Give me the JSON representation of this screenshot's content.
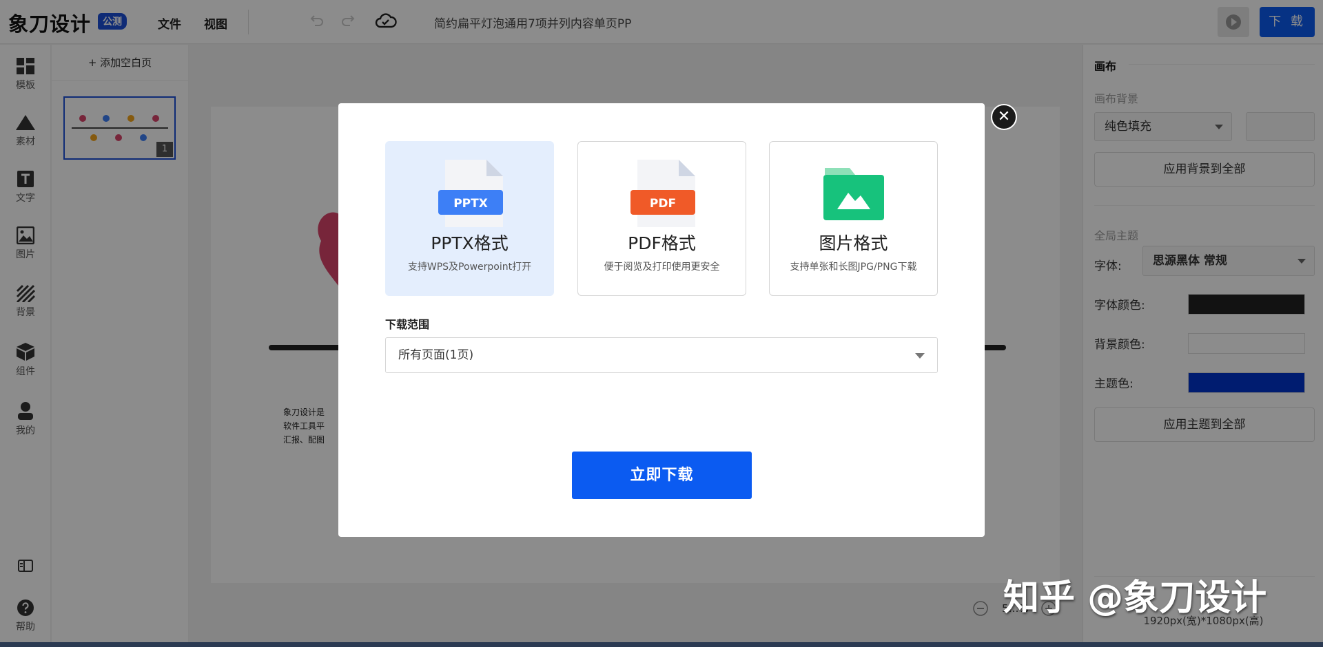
{
  "app": {
    "logo_text": "象刀设计",
    "beta_badge": "公测",
    "document_title": "简约扁平灯泡通用7项并列内容单页PP"
  },
  "topbar": {
    "menu": [
      "文件",
      "视图"
    ],
    "download_label": "下 载"
  },
  "iconbar": {
    "items": [
      {
        "label": "模板",
        "icon": "template-icon"
      },
      {
        "label": "素材",
        "icon": "material-icon"
      },
      {
        "label": "文字",
        "icon": "text-icon"
      },
      {
        "label": "图片",
        "icon": "image-icon"
      },
      {
        "label": "背景",
        "icon": "background-icon"
      },
      {
        "label": "组件",
        "icon": "component-icon"
      },
      {
        "label": "我的",
        "icon": "user-icon"
      }
    ],
    "help_label": "帮助"
  },
  "pages": {
    "add_label": "+ 添加空白页",
    "thumb_number": "1"
  },
  "canvas": {
    "slide_text": [
      "象刀设计是",
      "软件工具平",
      "汇报、配图"
    ],
    "zoom_text": "5…%"
  },
  "right_panel": {
    "canvas_heading": "画布",
    "bg_section": "画布背景",
    "bg_fill_value": "纯色填充",
    "apply_bg_label": "应用背景到全部",
    "theme_section": "全局主题",
    "font_label": "字体:",
    "font_value": "思源黑体 常规",
    "font_color_label": "字体颜色:",
    "bg_color_label": "背景颜色:",
    "theme_color_label": "主题色:",
    "apply_theme_label": "应用主题到全部",
    "dimensions": "1920px(宽)*1080px(高)",
    "colors": {
      "font": "#222222",
      "background": "#ffffff",
      "theme": "#0033cc"
    }
  },
  "modal": {
    "formats": [
      {
        "badge": "PPTX",
        "name": "PPTX格式",
        "desc": "支持WPS及Powerpoint打开",
        "selected": true,
        "color": "#3d7ff6"
      },
      {
        "badge": "PDF",
        "name": "PDF格式",
        "desc": "便于阅览及打印使用更安全",
        "selected": false,
        "color": "#f05a28"
      },
      {
        "badge": "",
        "name": "图片格式",
        "desc": "支持单张和长图JPG/PNG下载",
        "selected": false,
        "color": "#17c27c"
      }
    ],
    "range_label": "下载范围",
    "range_value": "所有页面(1页)",
    "confirm_label": "立即下载"
  },
  "watermark": "知乎 @象刀设计"
}
